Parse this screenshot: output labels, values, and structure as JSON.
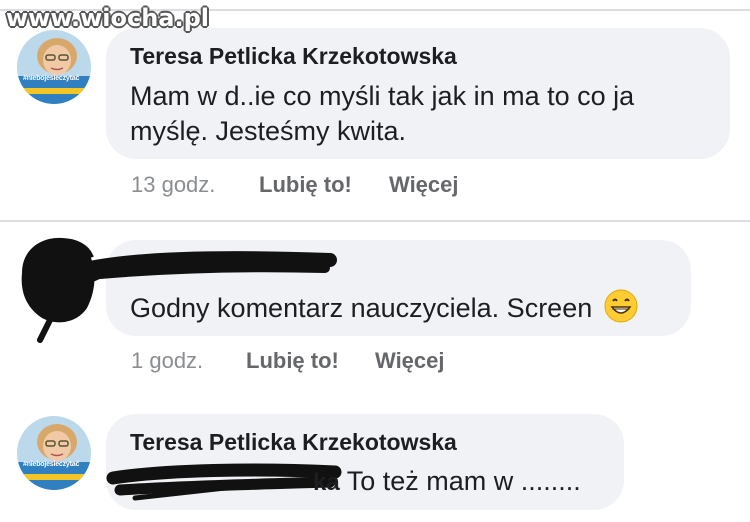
{
  "watermark": "www.wiocha.pl",
  "comments": [
    {
      "author": "Teresa Petlicka Krzekotowska",
      "text_line1": "Mam w d..ie co myśli tak jak in ma to co ja",
      "text_line2": "myślę. Jesteśmy kwita.",
      "time": "13 godz.",
      "like": "Lubię to!",
      "more": "Więcej",
      "avatar_tag": "#niebojesieczytać"
    },
    {
      "text": "Godny komentarz nauczyciela. Screen",
      "emoji": "grinning-face-emoji",
      "time": "1 godz.",
      "like": "Lubię to!",
      "more": "Więcej"
    },
    {
      "author": "Teresa Petlicka Krzekotowska",
      "mention_visible_fragment": "ka",
      "text": "To też mam w ........",
      "avatar_tag": "#niebojesieczytać"
    }
  ],
  "colors": {
    "bubble": "#f0f2f5",
    "text": "#1c1e21",
    "meta": "#65676b",
    "divider": "#dcdde1"
  }
}
